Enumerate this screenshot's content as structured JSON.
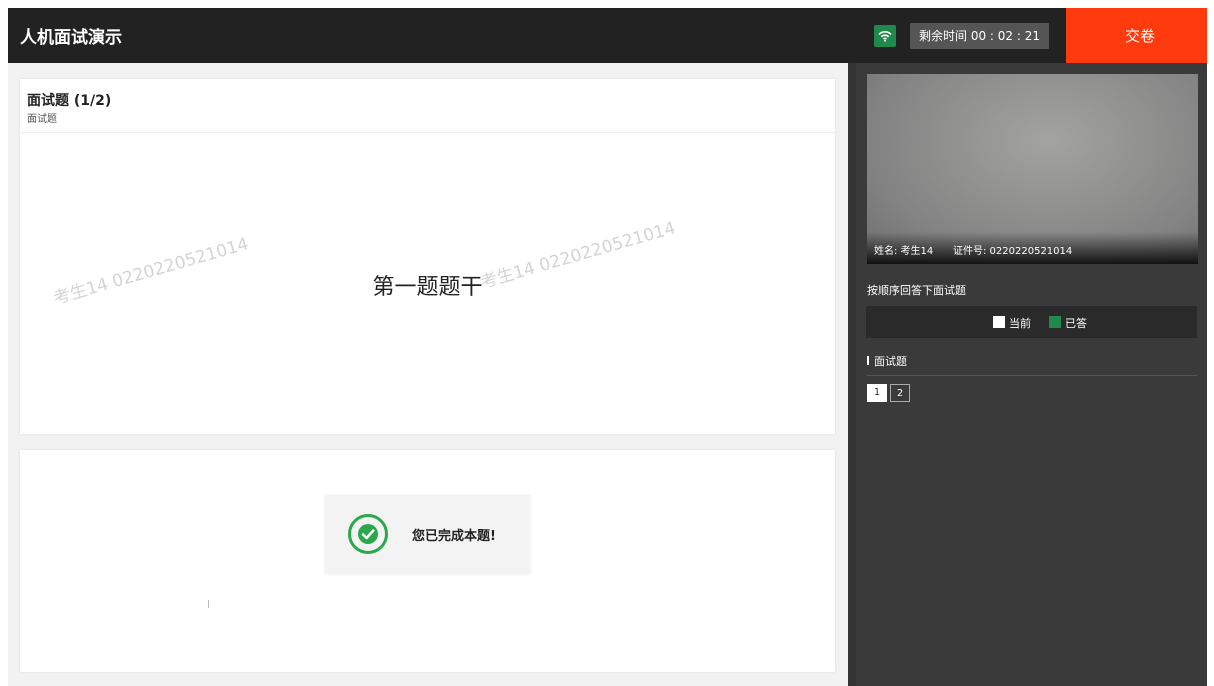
{
  "header": {
    "title": "人机面试演示",
    "timer": "剩余时间 00 : 02 : 21",
    "submit_label": "交卷",
    "wifi_icon": "wifi-icon"
  },
  "question": {
    "title": "面试题 (1/2)",
    "subtitle": "面试题",
    "stem": "第一题题干",
    "watermark": "考生14 0220220521014"
  },
  "answer": {
    "status": "您已完成本题!",
    "status_icon": "check-circle-icon"
  },
  "sidebar": {
    "cam_name": "姓名: 考生14",
    "cam_id": "证件号: 0220220521014",
    "instruction": "按顺序回答下面试题",
    "legend": {
      "current": "当前",
      "answered": "已答"
    },
    "section_title": "面试题",
    "questions": [
      "1",
      "2"
    ]
  },
  "colors": {
    "accent": "#ff3b0e",
    "answered": "#1f8a4c",
    "topbar": "#222222"
  }
}
